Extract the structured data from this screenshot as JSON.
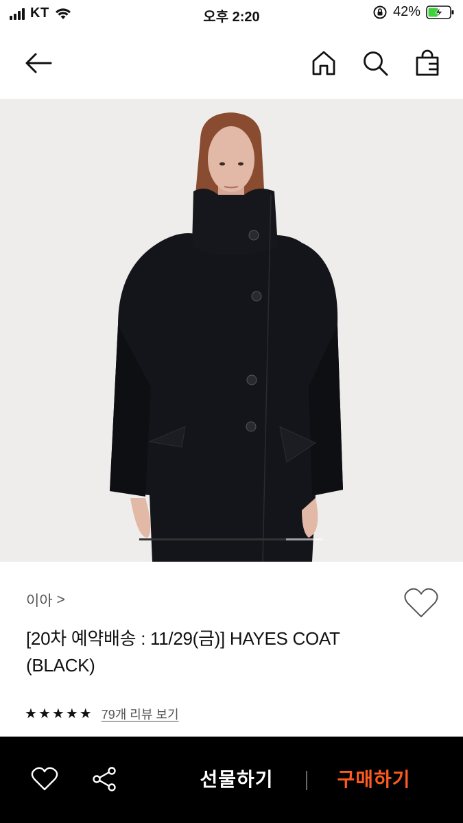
{
  "status_bar": {
    "carrier": "KT",
    "time": "오후 2:20",
    "battery": "42%"
  },
  "nav": {
    "icons": [
      "back-arrow-icon",
      "home-icon",
      "search-icon",
      "shopping-bag-icon"
    ]
  },
  "gallery": {
    "image_alt": "model wearing black stand-collar wool coat",
    "progress": 0.8
  },
  "product": {
    "brand": "이아",
    "brand_chevron": ">",
    "title": "[20차 예약배송 : 11/29(금)] HAYES COAT (BLACK)",
    "rating_stars": 5,
    "review_link": "79개 리뷰 보기"
  },
  "bottom_bar": {
    "gift_label": "선물하기",
    "buy_label": "구매하기",
    "buy_color": "#ff5a1f"
  }
}
